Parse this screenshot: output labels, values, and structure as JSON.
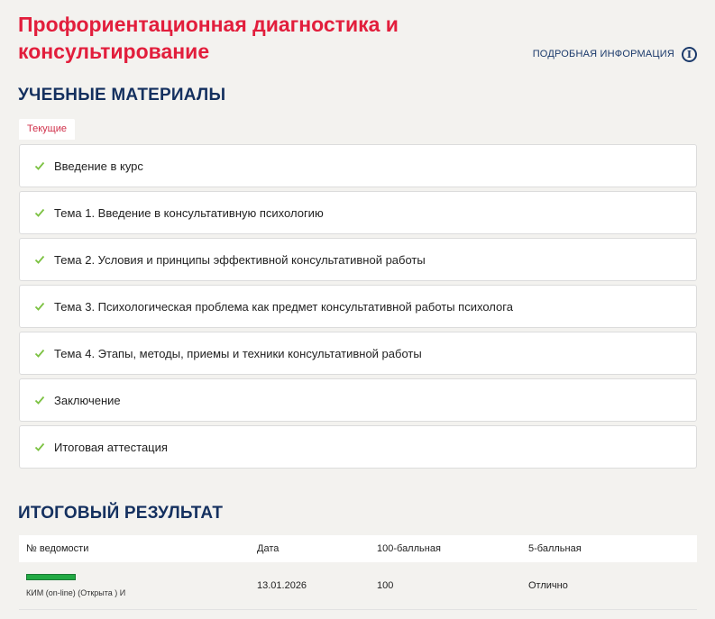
{
  "page": {
    "title": "Профориентационная диагностика и консультирование",
    "more_info_label": "ПОДРОБНАЯ ИНФОРМАЦИЯ"
  },
  "materials": {
    "section_title": "УЧЕБНЫЕ МАТЕРИАЛЫ",
    "tab_label": "Текущие",
    "modules": [
      {
        "label": "Введение в курс"
      },
      {
        "label": "Тема 1. Введение в консультативную психологию"
      },
      {
        "label": "Тема 2. Условия и принципы эффективной консультативной работы"
      },
      {
        "label": "Тема 3. Психологическая проблема как предмет консультативной работы психолога"
      },
      {
        "label": "Тема 4. Этапы, методы, приемы и техники консультативной работы"
      },
      {
        "label": "Заключение"
      },
      {
        "label": "Итоговая аттестация"
      }
    ]
  },
  "result": {
    "section_title": "ИТОГОВЫЙ РЕЗУЛЬТАТ",
    "columns": [
      "№ ведомости",
      "Дата",
      "100-балльная",
      "5-балльная"
    ],
    "rows": [
      {
        "sheet": "КИМ (on-line) (Открыта ) И",
        "progress_percent": 100,
        "date": "13.01.2026",
        "score100": "100",
        "score5": "Отлично"
      }
    ]
  },
  "colors": {
    "accent_red": "#e21e3c",
    "heading_navy": "#14305f",
    "check_green": "#7cc242",
    "progress_green": "#22aa44"
  },
  "icons": {
    "info": "info-circle-icon",
    "module_status": "check-icon"
  }
}
